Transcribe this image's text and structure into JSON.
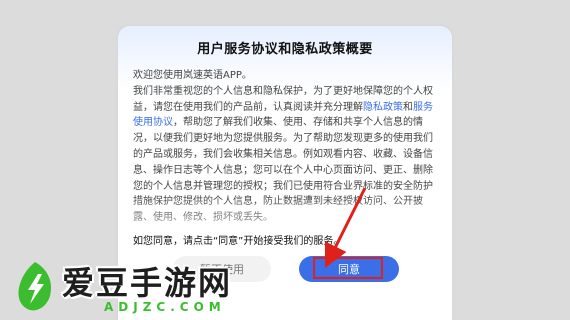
{
  "dialog": {
    "title": "用户服务协议和隐私政策概要",
    "welcome": "欢迎您使用岚速英语APP。",
    "para1_part1": "我们非常重视您的个人信息和隐私保护，为了更好地保障您的个人权益，请您在使用我们的产品前，认真阅读并充分理解",
    "privacy_policy_link": "隐私政策",
    "para1_and": "和",
    "service_agreement_link": "服务使用协议",
    "para1_part2": "，帮助您了解我们收集、使用、存储和共享个人信息的情况，以便我们更好地为您提供服务。为了帮助您发现更多的使用我们的产品或服务，我们会收集相关信息。例如观看内容、收藏、设备信息、操作日志等个人信息；您可以在个人中心页面访问、更正、删除您的个人信息并管理您的授权；我们已使用符合业界标准的安全防护措施保护您提供的个人信息，防止数据遭到未经授权访问、公开披露、使用、修改、损坏或丢失。",
    "confirm_text": "如您同意，请点击“同意”开始接受我们的服务。",
    "disagree_label": "暂不使用",
    "agree_label": "同意"
  },
  "watermark": {
    "brand": "爱豆手游网",
    "url": "ADJZC.COM"
  },
  "colors": {
    "accent": "#3a6fe8",
    "highlight": "#e0211b",
    "watermark_green": "#3bbd2f"
  }
}
